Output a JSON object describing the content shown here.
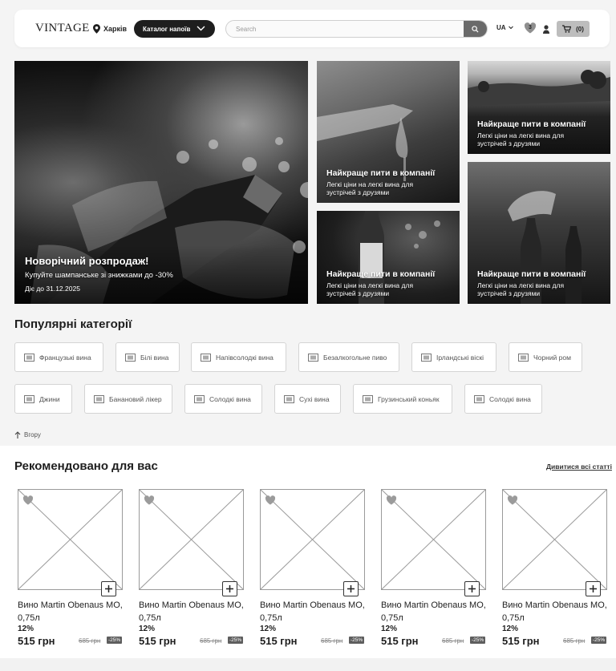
{
  "header": {
    "logo": "VINTAGE",
    "city": "Харків",
    "catalog_label": "Каталог напоїв",
    "search_placeholder": "Search",
    "lang": "UA",
    "favorites_count": "3",
    "cart_count": "(0)"
  },
  "banners": {
    "main": {
      "title": "Новорічний розпродаж!",
      "subtitle": "Купуйте шампанське зі знижками до -30%",
      "date": "Діє до 31.12.2025"
    },
    "small": [
      {
        "title": "Найкраще пити в компанії",
        "subtitle": "Легкі ціни на легкі вина для зустрічей з друзями"
      },
      {
        "title": "Найкраще пити в компанії",
        "subtitle": "Легкі ціни на легкі вина для зустрічей з друзями"
      },
      {
        "title": "Найкраще пити в компанії",
        "subtitle": "Легкі ціни на легкі вина для зустрічей з друзями"
      },
      {
        "title": "Найкраще пити в компанії",
        "subtitle": "Легкі ціни на легкі вина для зустрічей з друзями"
      }
    ]
  },
  "categories": {
    "title": "Популярні категорії",
    "items": [
      "Французькі вина",
      "Білі вина",
      "Напівсолодкі вина",
      "Безалкогольне пиво",
      "Ірландські віскі",
      "Чорний ром",
      "Джини",
      "Банановий лікер",
      "Солодкі вина",
      "Сухі вина",
      "Грузинський коньяк",
      "Солодкі вина"
    ],
    "back_label": "Вгору"
  },
  "recommended": {
    "title": "Рекомендовано для вас",
    "all_link": "Дивитися всі статті",
    "products": [
      {
        "name": "Вино Martin Obenaus МО, 0,75л",
        "percent": "12%",
        "price": "515 грн",
        "old_price": "685 грн",
        "discount": "-25%"
      },
      {
        "name": "Вино Martin Obenaus МО, 0,75л",
        "percent": "12%",
        "price": "515 грн",
        "old_price": "685 грн",
        "discount": "-25%"
      },
      {
        "name": "Вино Martin Obenaus МО, 0,75л",
        "percent": "12%",
        "price": "515 грн",
        "old_price": "685 грн",
        "discount": "-25%"
      },
      {
        "name": "Вино Martin Obenaus МО, 0,75л",
        "percent": "12%",
        "price": "515 грн",
        "old_price": "685 грн",
        "discount": "-25%"
      },
      {
        "name": "Вино Martin Obenaus МО, 0,75л",
        "percent": "12%",
        "price": "515 грн",
        "old_price": "685 грн",
        "discount": "-25%"
      }
    ]
  },
  "icons": [
    "location-pin-icon",
    "chevron-down-icon",
    "search-icon",
    "heart-icon",
    "user-icon",
    "cart-icon",
    "category-icon",
    "arrow-up-icon",
    "plus-icon"
  ]
}
